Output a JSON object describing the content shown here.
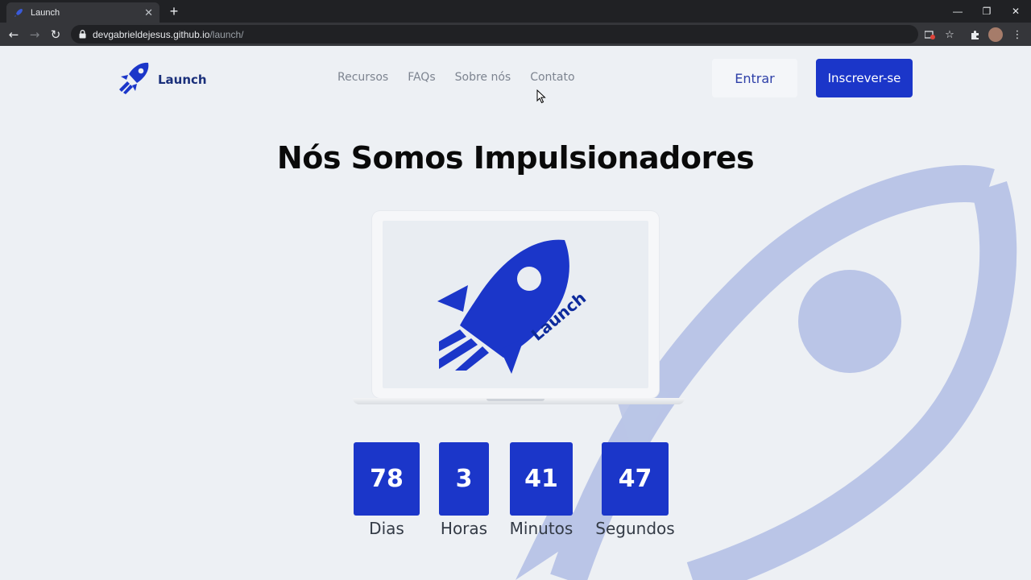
{
  "browser": {
    "tab_title": "Launch",
    "new_tab": "+",
    "url_host": "devgabrieldejesus.github.io",
    "url_path": "/launch/",
    "window_controls": {
      "minimize": "—",
      "restore": "❐",
      "close": "✕"
    }
  },
  "header": {
    "logo_text": "Launch",
    "nav": [
      "Recursos",
      "FAQs",
      "Sobre nós",
      "Contato"
    ],
    "login_label": "Entrar",
    "signup_label": "Inscrever-se"
  },
  "hero": {
    "title": "Nós Somos Impulsionadores",
    "screen_logo_text": "Launch"
  },
  "countdown": [
    {
      "value": "78",
      "label": "Dias"
    },
    {
      "value": "3",
      "label": "Horas"
    },
    {
      "value": "41",
      "label": "Minutos"
    },
    {
      "value": "47",
      "label": "Segundos"
    }
  ],
  "colors": {
    "brand": "#1b36c9",
    "brand_dark": "#1a2f7a",
    "bg_rocket": "#b9c4e6",
    "page_bg": "#edf0f4"
  }
}
